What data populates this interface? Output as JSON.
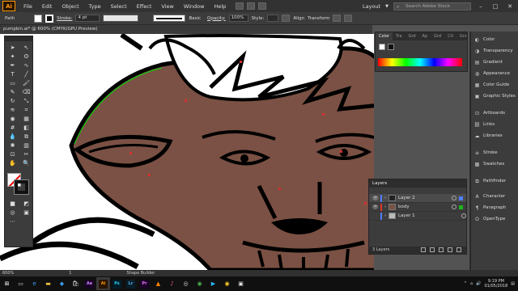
{
  "menubar": {
    "logo": "Ai",
    "items": [
      "File",
      "Edit",
      "Object",
      "Type",
      "Select",
      "Effect",
      "View",
      "Window",
      "Help"
    ],
    "workspace": "Layout",
    "search_placeholder": "Search Adobe Stock"
  },
  "control": {
    "selection_label": "Path",
    "stroke_label": "Stroke:",
    "stroke_weight": "4 pt",
    "brush_label": "Basic",
    "opacity_label": "Opacity:",
    "opacity_value": "100%",
    "style_label": "Style:",
    "align_label": "Align",
    "transform_label": "Transform"
  },
  "document": {
    "tab_title": "pumpkin.ai* @ 600% (CMYK/GPU Preview)"
  },
  "color_panel": {
    "tabs": [
      "Color",
      "Tra",
      "Grd",
      "Ap",
      "Grd",
      "Ctl",
      "Grs"
    ]
  },
  "dock": {
    "items": [
      {
        "label": "Color",
        "icon": "palette-icon"
      },
      {
        "label": "Transparency",
        "icon": "transparency-icon"
      },
      {
        "label": "Gradient",
        "icon": "gradient-icon"
      },
      {
        "label": "Appearance",
        "icon": "appearance-icon"
      },
      {
        "label": "Color Guide",
        "icon": "color-guide-icon"
      },
      {
        "label": "Graphic Styles",
        "icon": "graphic-styles-icon"
      },
      {
        "label": "Artboards",
        "icon": "artboards-icon"
      },
      {
        "label": "Links",
        "icon": "links-icon"
      },
      {
        "label": "Libraries",
        "icon": "libraries-icon"
      },
      {
        "label": "Stroke",
        "icon": "stroke-icon"
      },
      {
        "label": "Swatches",
        "icon": "swatches-icon"
      },
      {
        "label": "Pathfinder",
        "icon": "pathfinder-icon"
      },
      {
        "label": "Character",
        "icon": "character-icon"
      },
      {
        "label": "Paragraph",
        "icon": "paragraph-icon"
      },
      {
        "label": "OpenType",
        "icon": "opentype-icon"
      }
    ]
  },
  "layers": {
    "title": "Layers",
    "rows": [
      {
        "name": "Layer 2",
        "color": "#4f7fff",
        "selected": true
      },
      {
        "name": "body",
        "color": "#e0342f",
        "selected": false
      },
      {
        "name": "Layer 1",
        "color": "#4f7fff",
        "selected": false
      }
    ],
    "count": "3 Layers"
  },
  "status": {
    "zoom": "600%",
    "artboard": "1",
    "tool": "Shape Builder"
  },
  "taskbar": {
    "apps": [
      {
        "label": "Ai",
        "bg": "#2a1300",
        "fg": "#ff9a00"
      },
      {
        "label": "Ps",
        "bg": "#001d26",
        "fg": "#31c5f0"
      },
      {
        "label": "Lr",
        "bg": "#0a1d2a",
        "fg": "#4fb4e8"
      },
      {
        "label": "Pr",
        "bg": "#1b0028",
        "fg": "#e77bff"
      },
      {
        "label": "Ae",
        "bg": "#1a0026",
        "fg": "#d18cff"
      }
    ],
    "time": "9:19 PM",
    "date": "01/05/2018"
  },
  "colors": {
    "canvas_fill": "#7a5144",
    "path_accent": "#00e000",
    "anchor_red": "#d63030"
  }
}
